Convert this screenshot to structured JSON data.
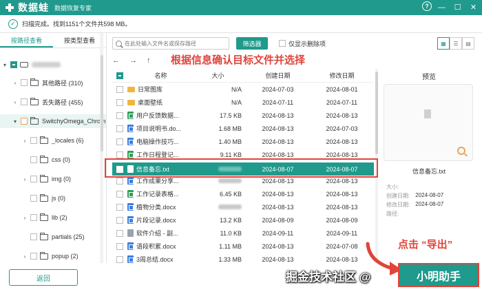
{
  "app": {
    "brand": "数据蛙",
    "subtitle": "数据恢复专家",
    "accent_color": "#1f9a8c",
    "annotation_color": "#e0443a",
    "window_buttons": [
      "?",
      "—",
      "☐",
      "✕"
    ]
  },
  "status": {
    "text": "扫描完成。找到1151个文件共598 MB。"
  },
  "left_tabs": [
    "按路径查看",
    "按类型查看"
  ],
  "tree": [
    {
      "label": "",
      "blurred": true,
      "checked": true
    },
    {
      "label": "其他路径 (310)"
    },
    {
      "label": "丢失路径 (455)"
    },
    {
      "label": "SwitchyOmega_Chrom"
    },
    {
      "label": "_locales (6)"
    },
    {
      "label": "css (0)"
    },
    {
      "label": "img (0)"
    },
    {
      "label": "js (0)"
    },
    {
      "label": "lib (2)"
    },
    {
      "label": "partials (25)"
    },
    {
      "label": "popup (2)"
    }
  ],
  "toolbar": {
    "search_placeholder": "在此处输入文件名或保存路径",
    "filter_label": "筛选器",
    "deleted_only_label": "仅显示删除项"
  },
  "nav": {
    "back": "←",
    "forward": "→",
    "up": "↑"
  },
  "annotations": {
    "top": "根据信息确认目标文件并选择",
    "export": "点击 “导出”"
  },
  "table": {
    "headers": {
      "name": "名称",
      "size": "大小",
      "created": "创建日期",
      "modified": "修改日期"
    },
    "rows": [
      {
        "name": "日常图库",
        "size": "N/A",
        "created": "2024-07-03",
        "modified": "2024-08-01",
        "type": "folder"
      },
      {
        "name": "桌面壁纸",
        "size": "N/A",
        "created": "2024-07-11",
        "modified": "2024-07-11",
        "type": "folder"
      },
      {
        "name": "用户反馈数据...",
        "size": "17.5 KB",
        "created": "2024-08-13",
        "modified": "2024-08-13",
        "type": "xls"
      },
      {
        "name": "项目说明书.do...",
        "size": "1.68 MB",
        "created": "2024-08-13",
        "modified": "2024-07-03",
        "type": "doc"
      },
      {
        "name": "电脑操作技巧...",
        "size": "1.40 MB",
        "created": "2024-08-13",
        "modified": "2024-08-13",
        "type": "doc"
      },
      {
        "name": "工作日程登记...",
        "size": "9.11 KB",
        "created": "2024-08-13",
        "modified": "2024-08-13",
        "type": "xls"
      },
      {
        "name": "信息备忘.txt",
        "size": "",
        "created": "2024-08-07",
        "modified": "2024-08-07",
        "type": "txt",
        "selected": true
      },
      {
        "name": "工作成果分享...",
        "size": "",
        "created": "2024-08-13",
        "modified": "2024-08-13",
        "type": "doc"
      },
      {
        "name": "工作记录表格...",
        "size": "6.45 KB",
        "created": "2024-08-13",
        "modified": "2024-08-13",
        "type": "xls"
      },
      {
        "name": "植物分类.docx",
        "size": "",
        "created": "2024-08-13",
        "modified": "2024-08-13",
        "type": "doc"
      },
      {
        "name": "片段记录.docx",
        "size": "13.2 KB",
        "created": "2024-08-09",
        "modified": "2024-08-09",
        "type": "doc"
      },
      {
        "name": "软件介绍 - 副...",
        "size": "11.0 KB",
        "created": "2024-09-11",
        "modified": "2024-09-11",
        "type": "txt"
      },
      {
        "name": "语段积累.docx",
        "size": "1.11 MB",
        "created": "2024-08-13",
        "modified": "2024-07-08",
        "type": "doc"
      },
      {
        "name": "3周总结.docx",
        "size": "1.33 MB",
        "created": "2024-08-13",
        "modified": "2024-08-13",
        "type": "doc"
      }
    ]
  },
  "preview": {
    "title": "预览",
    "file_name": "信息备忘.txt",
    "meta": [
      {
        "label": "大小:",
        "value": ""
      },
      {
        "label": "创建日期:",
        "value": "2024-08-07"
      },
      {
        "label": "修改日期:",
        "value": "2024-08-07"
      },
      {
        "label": "路径:",
        "value": ""
      }
    ]
  },
  "footer": {
    "back_label": "返回",
    "export_label": "小明助手",
    "watermark": "掘金技术社区 @"
  }
}
